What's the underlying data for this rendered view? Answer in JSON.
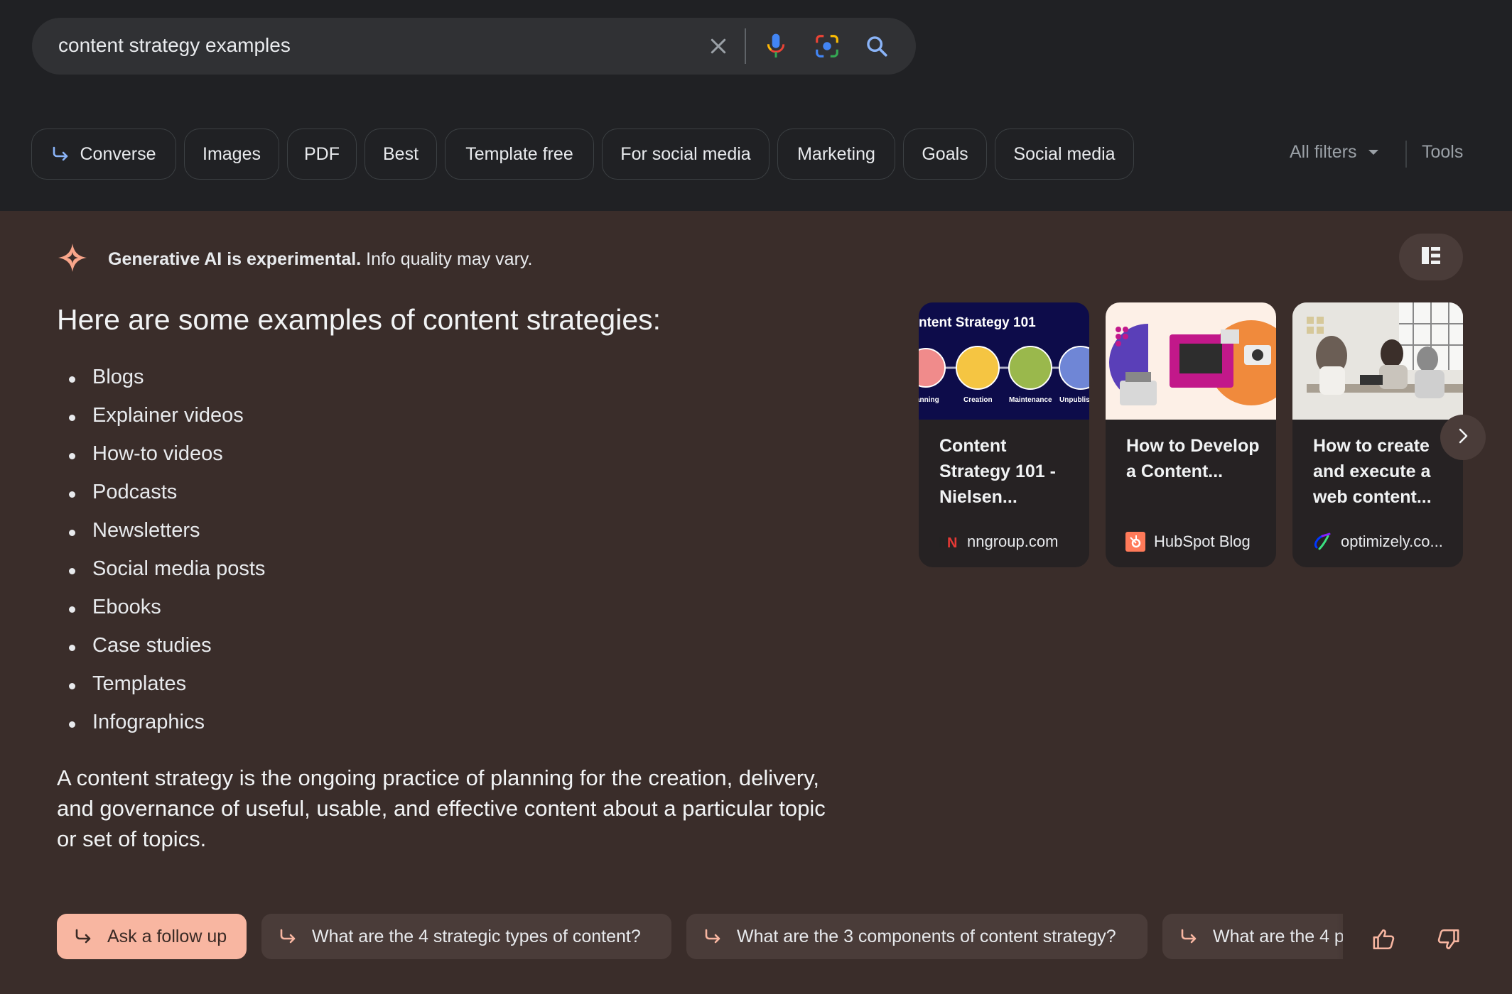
{
  "search": {
    "query": "content strategy examples"
  },
  "chips": [
    {
      "label": "Converse"
    },
    {
      "label": "Images"
    },
    {
      "label": "PDF"
    },
    {
      "label": "Best"
    },
    {
      "label": "Template free"
    },
    {
      "label": "For social media"
    },
    {
      "label": "Marketing"
    },
    {
      "label": "Goals"
    },
    {
      "label": "Social media"
    }
  ],
  "filters": {
    "all_filters": "All filters",
    "tools": "Tools"
  },
  "ai_overview": {
    "notice_bold": "Generative AI is experimental.",
    "notice_rest": " Info quality may vary.",
    "heading": "Here are some examples of content strategies:",
    "items": [
      "Blogs",
      "Explainer videos",
      "How-to videos",
      "Podcasts",
      "Newsletters",
      "Social media posts",
      "Ebooks",
      "Case studies",
      "Templates",
      "Infographics"
    ],
    "paragraph": "A content strategy is the ongoing practice of planning for the creation, delivery, and governance of useful, usable, and effective content about a particular topic or set of topics."
  },
  "cards": [
    {
      "title": "Content Strategy 101 - Nielsen...",
      "source": "nngroup.com",
      "image_heading": "ntent Strategy 101",
      "image_labels": [
        "anning",
        "Creation",
        "Maintenance",
        "Unpublis"
      ]
    },
    {
      "title": "How to Develop a Content...",
      "source": "HubSpot Blog"
    },
    {
      "title": "How to create and execute a web content...",
      "source": "optimizely.co..."
    }
  ],
  "followups": {
    "ask": "Ask a follow up",
    "questions": [
      "What are the 4 strategic types of content?",
      "What are the 3 components of content strategy?",
      "What are the 4 p"
    ]
  },
  "colors": {
    "top_bg": "#202124",
    "ai_bg": "#3a2d2a",
    "accent_salmon": "#f8b6a1",
    "blue": "#8ab4f8"
  }
}
